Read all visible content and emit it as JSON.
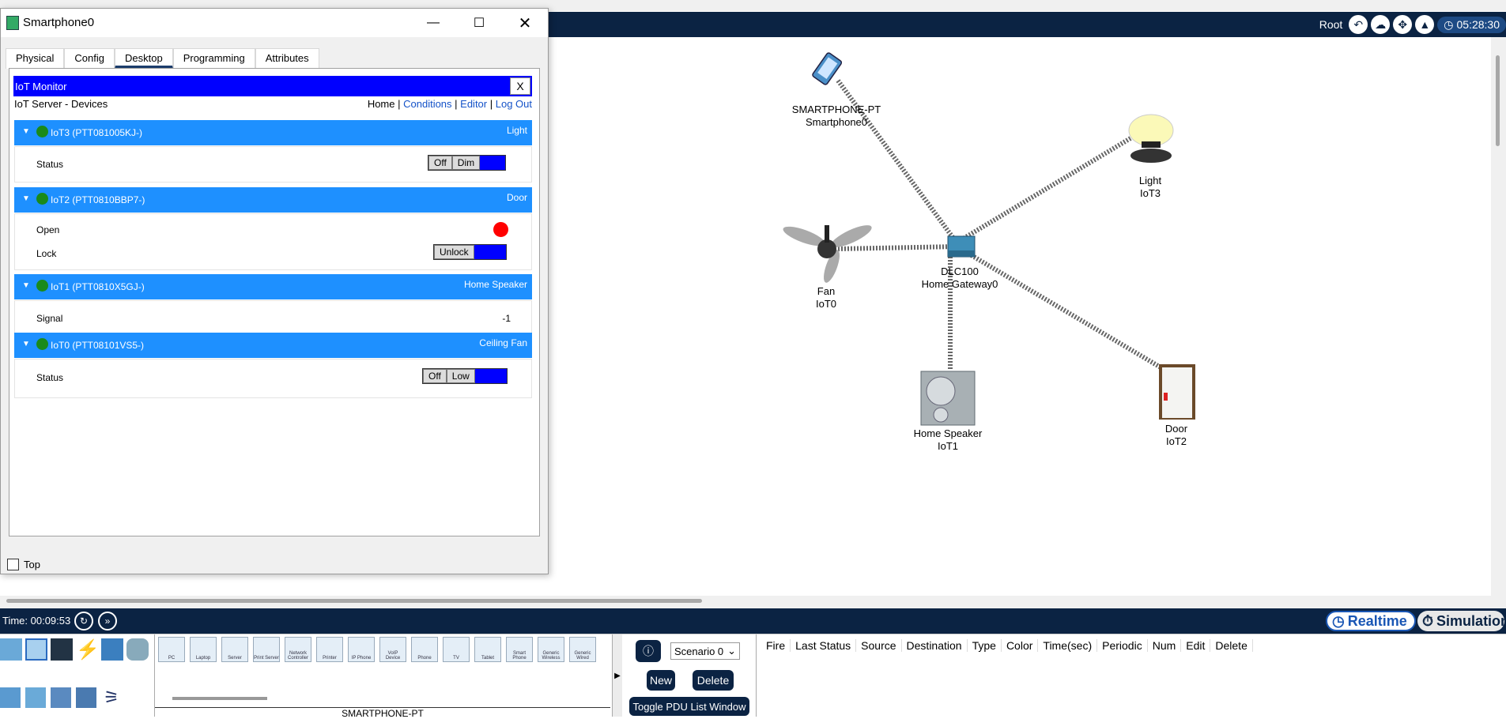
{
  "topbar": {
    "root_label": "Root",
    "time": "05:28:30"
  },
  "window": {
    "title": "Smartphone0",
    "tabs": [
      "Physical",
      "Config",
      "Desktop",
      "Programming",
      "Attributes"
    ],
    "active_tab": "Desktop",
    "iot_monitor_title": "IoT Monitor",
    "close_label": "X",
    "server_label": "IoT Server - Devices",
    "links": [
      "Home",
      "Conditions",
      "Editor",
      "Log Out"
    ],
    "devices": [
      {
        "name": "IoT3 (PTT081005KJ-)",
        "type": "Light",
        "rows": [
          {
            "label": "Status",
            "buttons": [
              "Off",
              "Dim"
            ]
          }
        ]
      },
      {
        "name": "IoT2 (PTT0810BBP7-)",
        "type": "Door",
        "rows": [
          {
            "label": "Open",
            "indicator": "red"
          },
          {
            "label": "Lock",
            "buttons": [
              "Unlock"
            ]
          }
        ]
      },
      {
        "name": "IoT1 (PTT0810X5GJ-)",
        "type": "Home Speaker",
        "rows": [
          {
            "label": "Signal",
            "value": "-1"
          }
        ]
      },
      {
        "name": "IoT0 (PTT08101VS5-)",
        "type": "Ceiling Fan",
        "rows": [
          {
            "label": "Status",
            "buttons": [
              "Off",
              "Low"
            ]
          }
        ]
      }
    ],
    "top_checkbox_label": "Top"
  },
  "network": {
    "devices": [
      {
        "line1": "SMARTPHONE-PT",
        "line2": "Smartphone0"
      },
      {
        "line1": "Light",
        "line2": "IoT3"
      },
      {
        "line1": "Fan",
        "line2": "IoT0"
      },
      {
        "line1": "DLC100",
        "line2": "Home Gateway0"
      },
      {
        "line1": "Home Speaker",
        "line2": "IoT1"
      },
      {
        "line1": "Door",
        "line2": "IoT2"
      }
    ]
  },
  "bottom": {
    "time_label": "Time: 00:09:53",
    "realtime_label": "Realtime",
    "simulation_label": "Simulation",
    "palette": [
      "PC",
      "Laptop",
      "Server",
      "Print Server",
      "Network Controller",
      "Printer",
      "IP Phone",
      "VoIP Device",
      "Phone",
      "TV",
      "Tablet",
      "Smart Phone",
      "Generic Wireless",
      "Generic Wired"
    ],
    "selected_device_label": "SMARTPHONE-PT",
    "scenario": "Scenario 0",
    "new_label": "New",
    "delete_label": "Delete",
    "toggle_label": "Toggle PDU List Window",
    "pdu_columns": [
      "Fire",
      "Last Status",
      "Source",
      "Destination",
      "Type",
      "Color",
      "Time(sec)",
      "Periodic",
      "Num",
      "Edit",
      "Delete"
    ]
  },
  "colors": {
    "navy": "#0b2343",
    "iot_blue": "#1e90ff",
    "monitor_blue": "#0000ff",
    "status_green": "#1a8a1a",
    "indicator_red": "#ff0000"
  }
}
